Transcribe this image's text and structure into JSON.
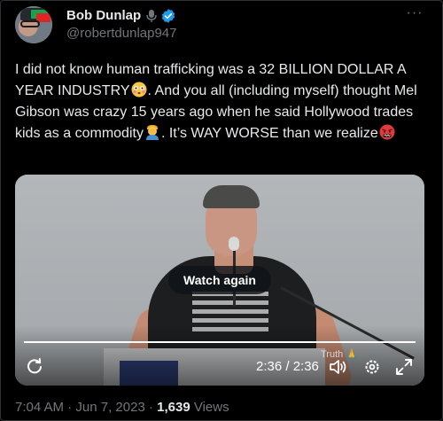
{
  "author": {
    "display_name": "Bob Dunlap",
    "handle": "@robertdunlap947",
    "avatar_icon": "avatar-photo",
    "badges": [
      "microphone-icon",
      "verified-icon"
    ],
    "verified_color": "#1d9bf0"
  },
  "more_label": "···",
  "tweet": {
    "segments": [
      {
        "type": "text",
        "text": "I did not know human trafficking was a 32 BILLION DOLLAR A YEAR INDUSTRY"
      },
      {
        "type": "emoji",
        "name": "flushed-face-emoji"
      },
      {
        "type": "text",
        "text": ". And you all (including myself) thought Mel Gibson was crazy 15 years ago when he said Hollywood trades kids as a commodity"
      },
      {
        "type": "emoji",
        "name": "person-facepalming-emoji"
      },
      {
        "type": "text",
        "text": ". It’s WAY WORSE than we realize"
      },
      {
        "type": "emoji",
        "name": "angry-symbols-face-emoji"
      }
    ]
  },
  "video": {
    "watch_again_label": "Watch again",
    "time": "2:36 / 2:36",
    "progress": 1.0,
    "watermark": "Truth 🙏",
    "controls": [
      "replay-icon",
      "volume-icon",
      "settings-icon",
      "fullscreen-icon"
    ]
  },
  "meta": {
    "time": "7:04 AM",
    "separator": "·",
    "date": "Jun 7, 2023",
    "views": "1,639",
    "views_label": "Views"
  },
  "colors": {
    "background": "#000000",
    "text": "#e7e9ea",
    "secondary": "#71767b",
    "accent": "#1d9bf0"
  }
}
